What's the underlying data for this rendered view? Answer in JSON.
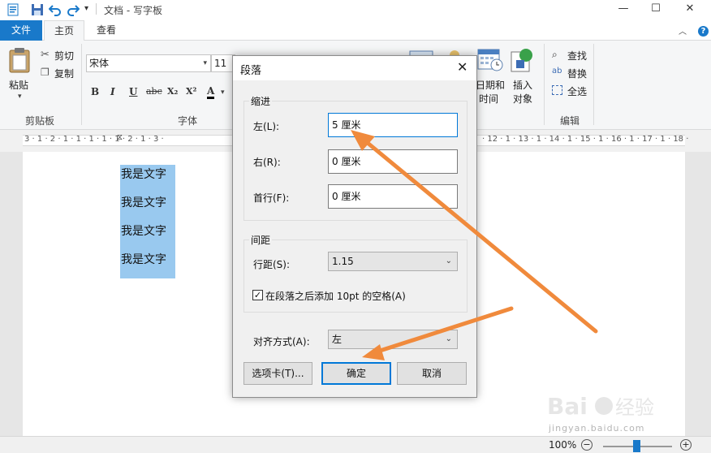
{
  "app": {
    "title": "文档 - 写字板"
  },
  "tabs": {
    "file": "文件",
    "home": "主页",
    "view": "查看"
  },
  "ribbon": {
    "clipboard": {
      "paste": "粘贴",
      "cut": "剪切",
      "copy": "复制",
      "label": "剪贴板"
    },
    "font": {
      "family": "宋体",
      "size": "11",
      "label": "字体",
      "bold": "B",
      "italic": "I",
      "underline": "U",
      "strike": "abc",
      "sub": "X₂",
      "sup": "X²",
      "color": "A"
    },
    "insert": {
      "datetime_line1": "日期和",
      "datetime_line2": "时间",
      "object_line1": "插入",
      "object_line2": "对象"
    },
    "editing": {
      "find": "查找",
      "replace": "替换",
      "select_all": "全选",
      "label": "编辑"
    }
  },
  "ruler": {
    "ticks": "3 · 1 · 2 · 1 · 1 · 1 · 1 · 1 · 2 · 1 · 3 ·",
    "ticks_right": "· 12 · 1 · 13 · 1 · 14 · 1 · 15 · 1 · 16 · 1 · 17 · 1 · 18 ·"
  },
  "document": {
    "lines": [
      "我是文字",
      "我是文字",
      "我是文字",
      "我是文字"
    ]
  },
  "status": {
    "zoom": "100%",
    "zoom_out": "−",
    "zoom_in": "+"
  },
  "dialog": {
    "title": "段落",
    "close": "✕",
    "indent": {
      "legend": "缩进",
      "left_label": "左(L):",
      "left_value": "5 厘米",
      "right_label": "右(R):",
      "right_value": "0 厘米",
      "first_label": "首行(F):",
      "first_value": "0 厘米"
    },
    "spacing": {
      "legend": "间距",
      "line_label": "行距(S):",
      "line_value": "1.15",
      "add_space_label": "在段落之后添加 10pt 的空格(A)",
      "add_space_checked": "✓"
    },
    "align": {
      "label": "对齐方式(A):",
      "value": "左"
    },
    "buttons": {
      "tabs": "选项卡(T)...",
      "ok": "确定",
      "cancel": "取消"
    }
  },
  "watermark": {
    "text": "jingyan.baidu.com"
  },
  "colors": {
    "accent": "#1979ca",
    "arrow": "#f08a3c",
    "selection": "#99c9ef"
  }
}
